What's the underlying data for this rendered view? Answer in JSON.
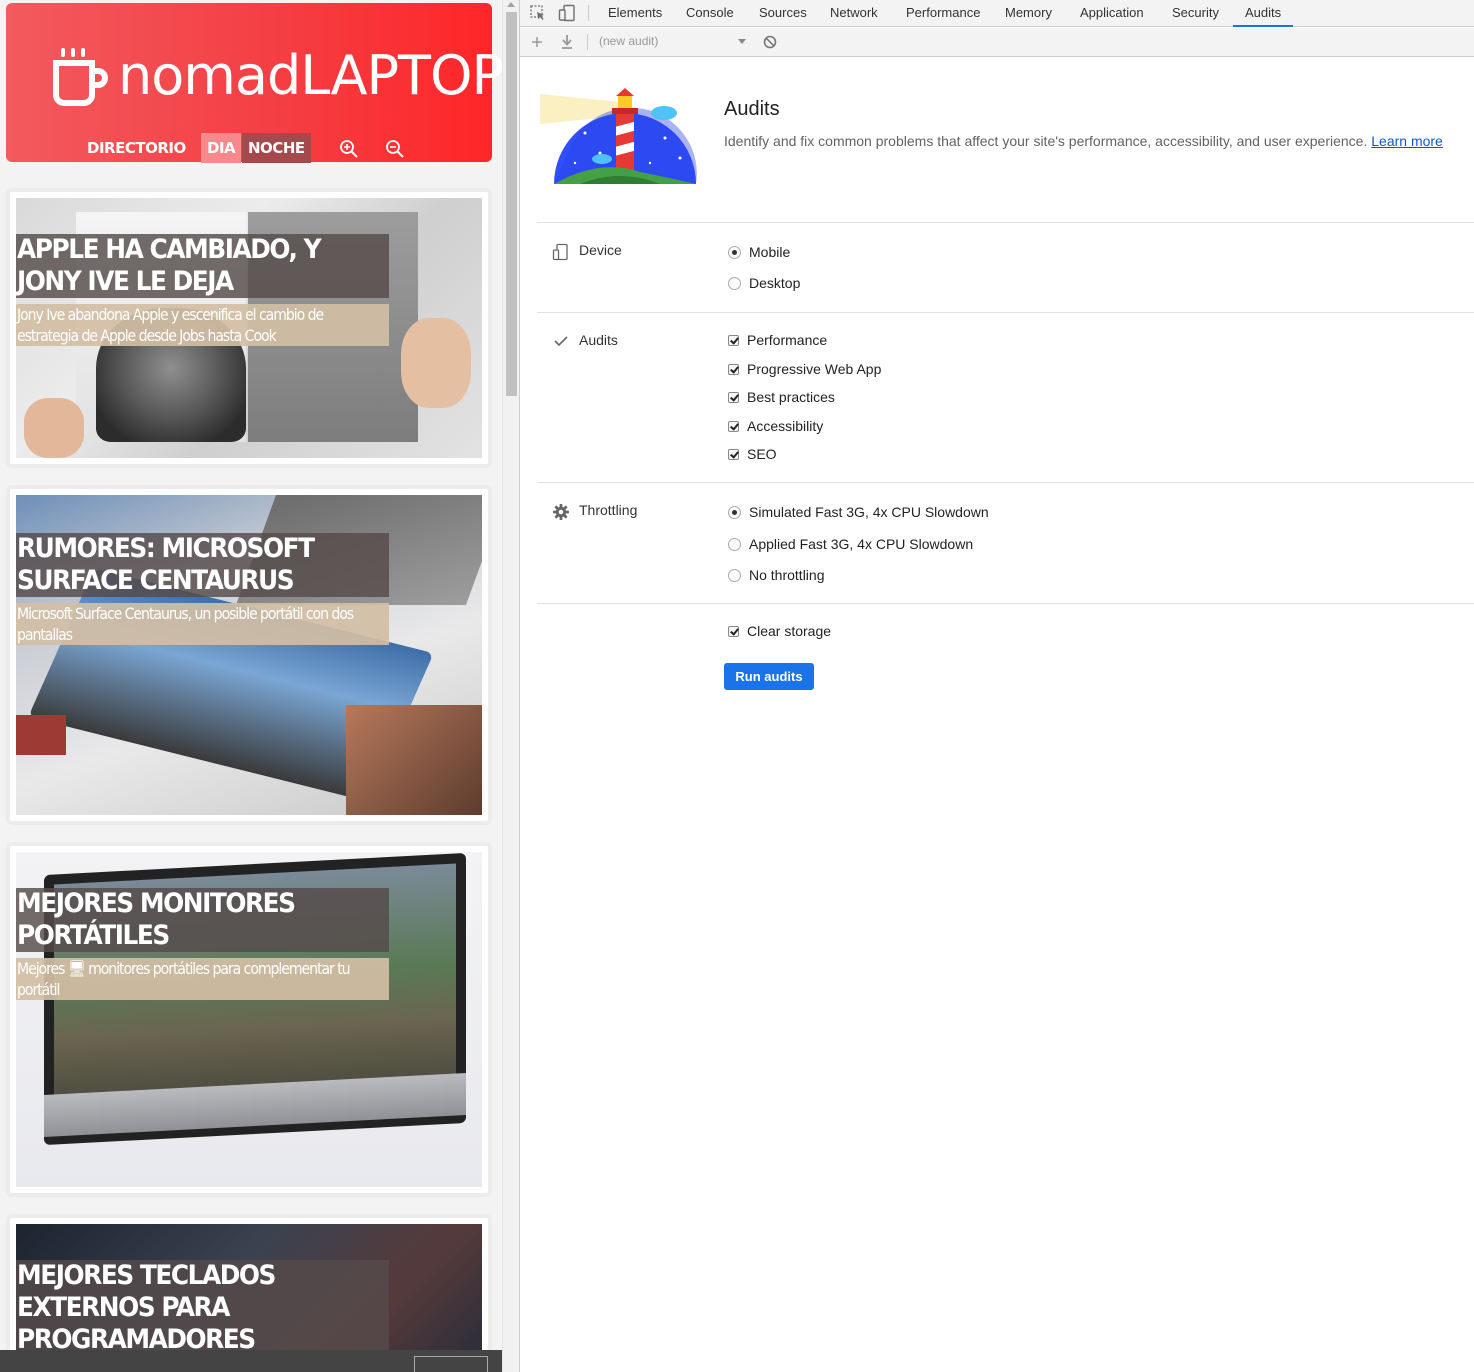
{
  "site": {
    "brand": "nomadLAPTOP",
    "nav": {
      "directory": "DIRECTORIO",
      "day": "DIA",
      "night": "NOCHE"
    },
    "cards": [
      {
        "title": [
          "APPLE HA CAMBIADO, Y",
          "JONY IVE LE DEJA"
        ],
        "subtitle": [
          "Jony Ive abandona Apple y escenifica el cambio de",
          "estrategia de Apple desde Jobs hasta Cook"
        ]
      },
      {
        "title": [
          "RUMORES: MICROSOFT",
          "SURFACE CENTAURUS"
        ],
        "subtitle": [
          "Microsoft Surface Centaurus, un posible portátil con dos",
          "pantallas"
        ]
      },
      {
        "title": [
          "MEJORES MONITORES",
          "PORTÁTILES"
        ],
        "subtitle": [
          "Mejores 🖥 monitores portátiles para complementar tu",
          "portátil"
        ]
      },
      {
        "title": [
          "MEJORES TECLADOS",
          "EXTERNOS PARA",
          "PROGRAMADORES"
        ],
        "subtitle": []
      }
    ]
  },
  "devtools": {
    "tabs": [
      "Elements",
      "Console",
      "Sources",
      "Network",
      "Performance",
      "Memory",
      "Application",
      "Security",
      "Audits"
    ],
    "active_tab": "Audits",
    "toolbar": {
      "audit_select": "(new audit)"
    },
    "header": {
      "title": "Audits",
      "description": "Identify and fix common problems that affect your site's performance, accessibility, and user experience.",
      "learn_more": "Learn more"
    },
    "device": {
      "label": "Device",
      "options": [
        "Mobile",
        "Desktop"
      ],
      "selected": "Mobile"
    },
    "audits": {
      "label": "Audits",
      "categories": [
        {
          "label": "Performance",
          "checked": true
        },
        {
          "label": "Progressive Web App",
          "checked": true
        },
        {
          "label": "Best practices",
          "checked": true
        },
        {
          "label": "Accessibility",
          "checked": true
        },
        {
          "label": "SEO",
          "checked": true
        }
      ]
    },
    "throttling": {
      "label": "Throttling",
      "options": [
        "Simulated Fast 3G, 4x CPU Slowdown",
        "Applied Fast 3G, 4x CPU Slowdown",
        "No throttling"
      ],
      "selected": "Simulated Fast 3G, 4x CPU Slowdown"
    },
    "clear_storage": {
      "label": "Clear storage",
      "checked": true
    },
    "run_button": "Run audits"
  }
}
